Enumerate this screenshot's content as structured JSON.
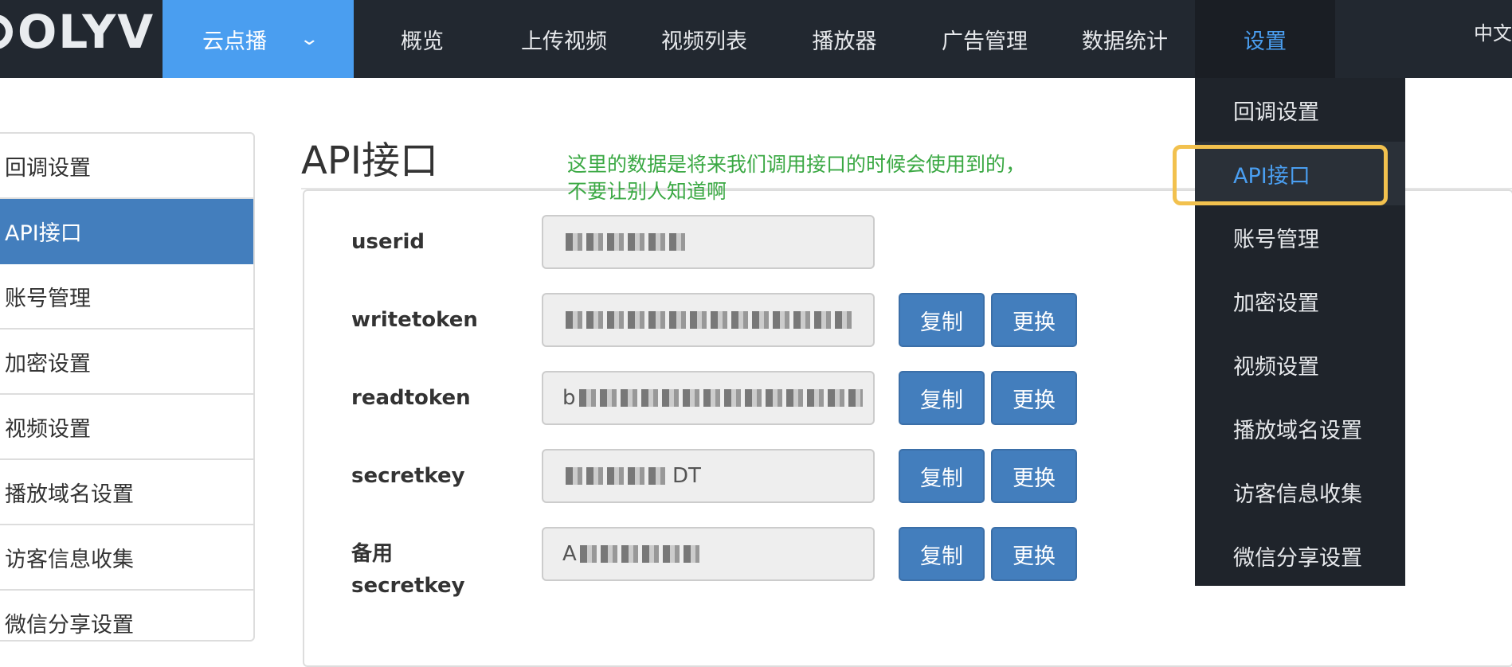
{
  "navbar": {
    "logo": "OLYV",
    "product": "云点播",
    "items": [
      "概览",
      "上传视频",
      "视频列表",
      "播放器",
      "广告管理",
      "数据统计",
      "设置"
    ],
    "active": "设置",
    "language": "中文"
  },
  "sidebar": {
    "items": [
      "回调设置",
      "API接口",
      "账号管理",
      "加密设置",
      "视频设置",
      "播放域名设置",
      "访客信息收集",
      "微信分享设置"
    ],
    "active": "API接口"
  },
  "main": {
    "title": "API接口",
    "annotation_line1": "这里的数据是将来我们调用接口的时候会使用到的，",
    "annotation_line2": "不要让别人知道啊",
    "fields": [
      {
        "label": "userid",
        "value_prefix": ""
      },
      {
        "label": "writetoken",
        "value_prefix": ""
      },
      {
        "label": "readtoken",
        "value_prefix": "b"
      },
      {
        "label": "secretkey",
        "value_prefix": "",
        "value_suffix": "DT"
      },
      {
        "label_line1": "备用",
        "label_line2": "secretkey",
        "value_prefix": "A"
      }
    ],
    "copy_label": "复制",
    "change_label": "更换"
  },
  "dropdown": {
    "items": [
      "回调设置",
      "API接口",
      "账号管理",
      "加密设置",
      "视频设置",
      "播放域名设置",
      "访客信息收集",
      "微信分享设置"
    ],
    "active": "API接口"
  },
  "colors": {
    "navbar_bg": "#222830",
    "accent": "#4a9ef0",
    "button": "#437ebd",
    "annotation": "#3aa843",
    "highlight": "#f2c14e"
  }
}
